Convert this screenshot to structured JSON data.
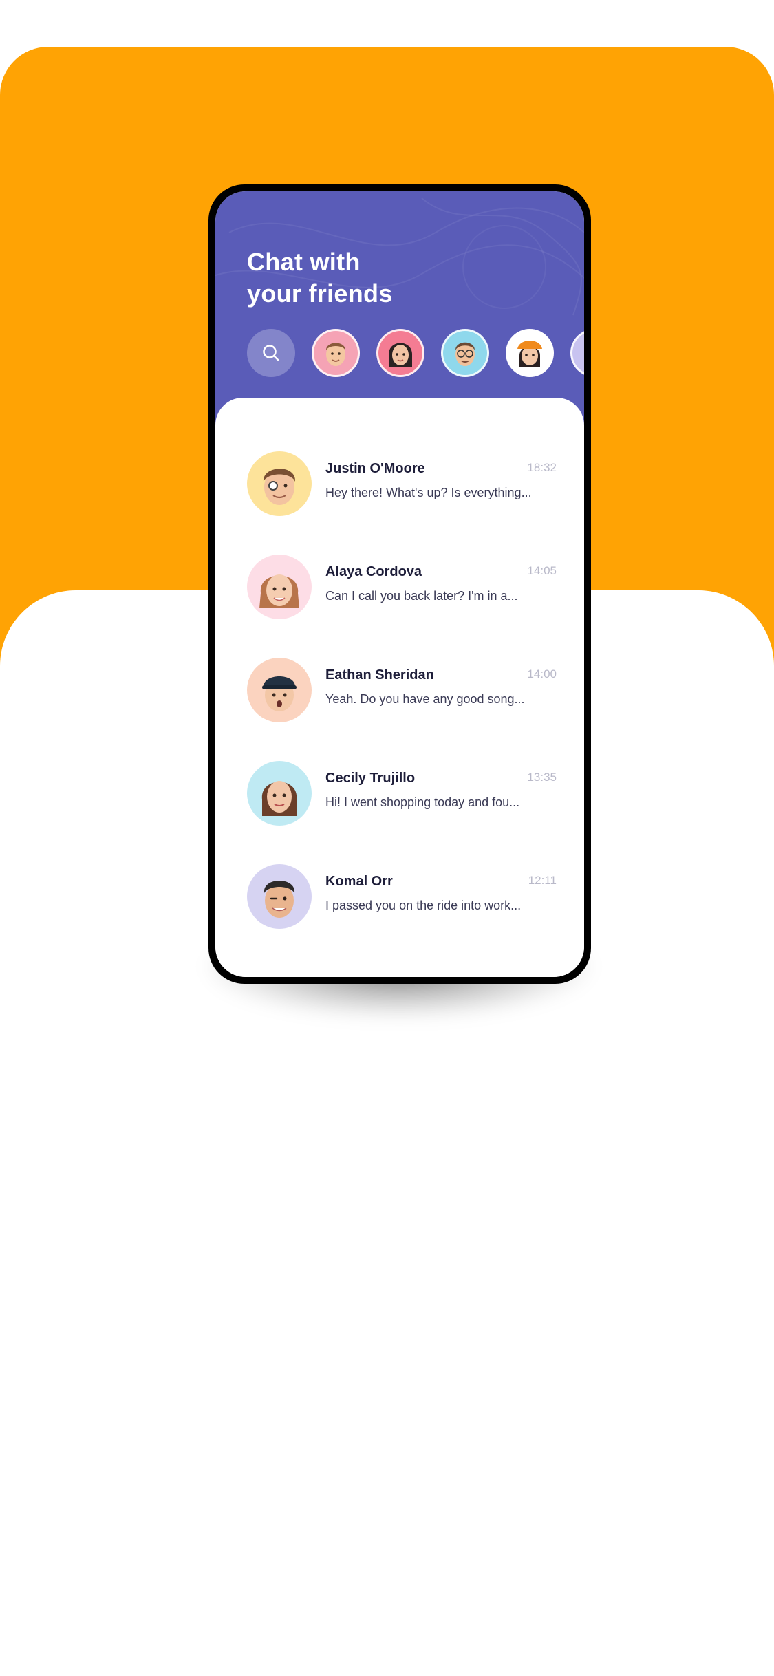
{
  "colors": {
    "background_accent": "#FFA304",
    "header": "#5A5CB8",
    "name_text": "#1E1E3A",
    "time_text": "#B9B9C9"
  },
  "header": {
    "title_line1": "Chat with",
    "title_line2": "your friends",
    "search_icon": "search-icon"
  },
  "stories": [
    {
      "name": "story-1",
      "bg": "#F5A3B5"
    },
    {
      "name": "story-2",
      "bg": "#F47C93"
    },
    {
      "name": "story-3",
      "bg": "#8FD8EC"
    },
    {
      "name": "story-4",
      "bg": "#FFFFFF"
    },
    {
      "name": "story-5",
      "bg": "#C8C3F0"
    }
  ],
  "chats": [
    {
      "name": "Justin O'Moore",
      "time": "18:32",
      "message": "Hey there! What's up? Is everything...",
      "avatar_bg": "#FDE39A"
    },
    {
      "name": "Alaya Cordova",
      "time": "14:05",
      "message": "Can I call you back later? I'm in a...",
      "avatar_bg": "#FDDDE6"
    },
    {
      "name": "Eathan Sheridan",
      "time": "14:00",
      "message": "Yeah. Do you have any good song...",
      "avatar_bg": "#FBD3BF"
    },
    {
      "name": "Cecily Trujillo",
      "time": "13:35",
      "message": "Hi! I went shopping today and fou...",
      "avatar_bg": "#BFEAF3"
    },
    {
      "name": "Komal Orr",
      "time": "12:11",
      "message": "I passed you on the ride into work...",
      "avatar_bg": "#D6D3F2"
    }
  ]
}
